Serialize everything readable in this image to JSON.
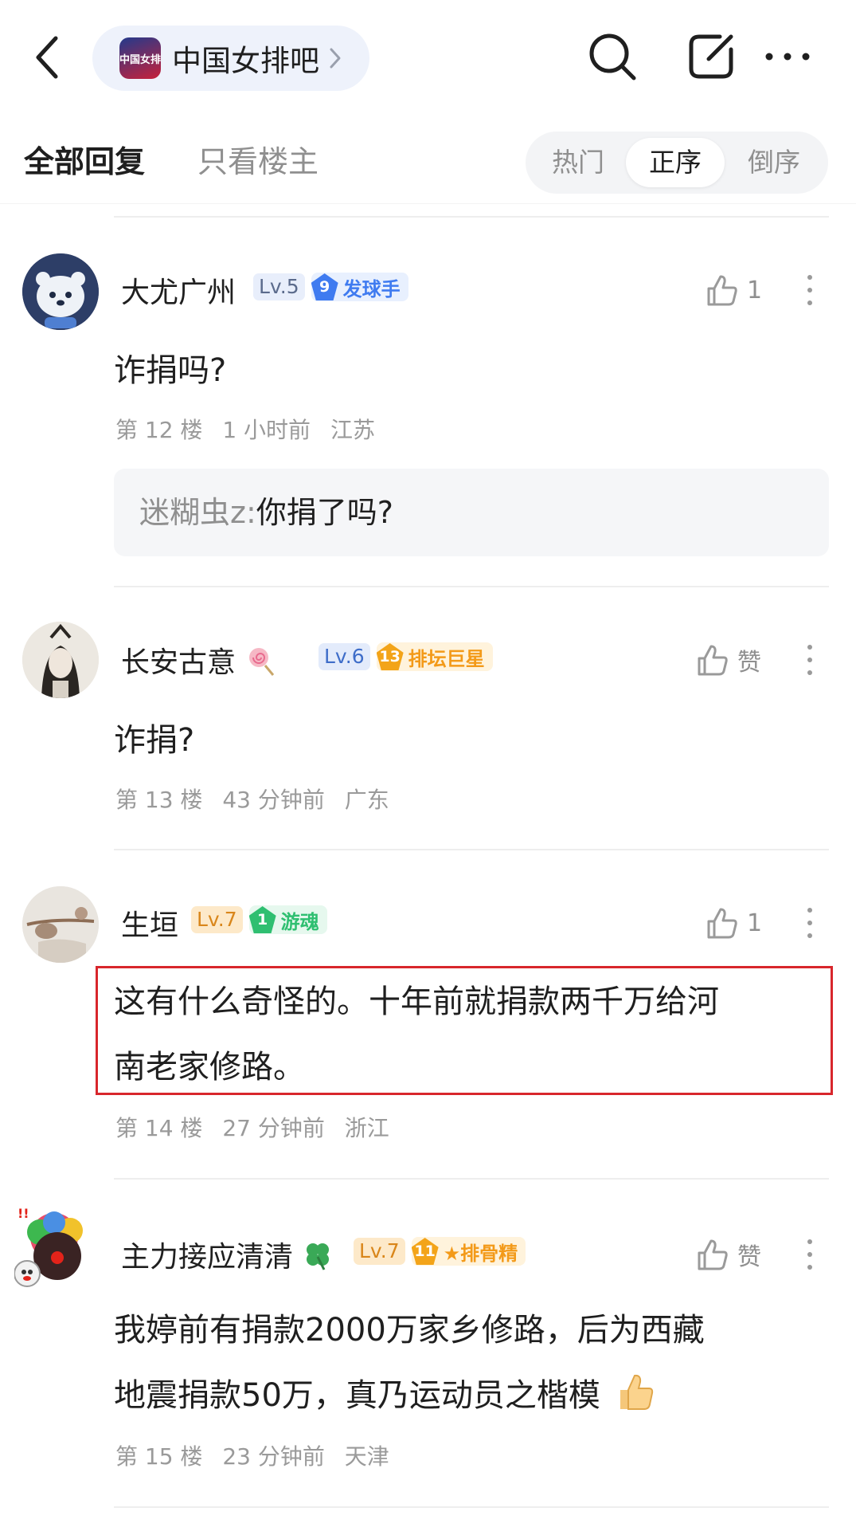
{
  "header": {
    "forum_name": "中国女排吧",
    "forum_logo_text": "中国女排",
    "icons": [
      "back-icon",
      "search-icon",
      "edit-icon",
      "more-icon"
    ]
  },
  "tabs": {
    "all_replies": "全部回复",
    "op_only": "只看楼主",
    "sort": [
      "热门",
      "正序",
      "倒序"
    ],
    "active_sort": "正序"
  },
  "posts": [
    {
      "username": "大尤广州",
      "level": "Lv.5",
      "honor_num": "9",
      "honor_title": "发球手",
      "likes": "1",
      "content": "诈捐吗?",
      "floor": "第 12 楼",
      "time": "1 小时前",
      "location": "江苏",
      "reply": {
        "name": "迷糊虫z:",
        "text": "你捐了吗?"
      }
    },
    {
      "username": "长安古意",
      "level": "Lv.6",
      "honor_num": "13",
      "honor_title": "排坛巨星",
      "likes": "赞",
      "content": "诈捐?",
      "floor": "第 13 楼",
      "time": "43 分钟前",
      "location": "广东"
    },
    {
      "username": "生垣",
      "level": "Lv.7",
      "honor_num": "1",
      "honor_title": "游魂",
      "likes": "1",
      "content_line1": "这有什么奇怪的。十年前就捐款两千万给河",
      "content_line2": "南老家修路。",
      "floor": "第 14 楼",
      "time": "27 分钟前",
      "location": "浙江"
    },
    {
      "username": "主力接应清清",
      "level": "Lv.7",
      "honor_num": "11",
      "honor_title": "★排骨精",
      "likes": "赞",
      "content_line1": "我婷前有捐款2000万家乡修路，后为西藏",
      "content_line2": "地震捐款50万，真乃运动员之楷模",
      "floor": "第 15 楼",
      "time": "23 分钟前",
      "location": "天津"
    }
  ],
  "colors": {
    "highlight_border": "#d8262c",
    "lv5_bg": "#e8eefb",
    "lv7_bg": "#fde9c9",
    "honor_blue": "#3f7bf0",
    "honor_gold": "#f3a419",
    "honor_green": "#2fbf71"
  }
}
